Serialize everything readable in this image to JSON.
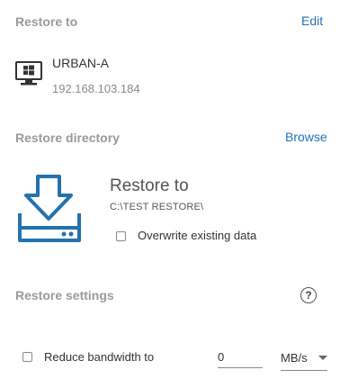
{
  "restore_to": {
    "title": "Restore to",
    "edit_label": "Edit",
    "host_name": "URBAN-A",
    "host_ip": "192.168.103.184",
    "host_icon": "monitor-windows-icon"
  },
  "restore_directory": {
    "title": "Restore directory",
    "browse_label": "Browse",
    "icon": "download-to-drive-icon",
    "heading": "Restore to",
    "path": "C:\\TEST RESTORE\\",
    "overwrite_label": "Overwrite existing data",
    "overwrite_checked": false
  },
  "restore_settings": {
    "title": "Restore settings",
    "help_icon": "help-icon",
    "reduce_bandwidth_label": "Reduce bandwidth to",
    "reduce_bandwidth_checked": false,
    "bandwidth_value": "0",
    "bandwidth_unit": "MB/s"
  },
  "colors": {
    "accent": "#1e73be",
    "section_title": "#9a9a9a"
  }
}
